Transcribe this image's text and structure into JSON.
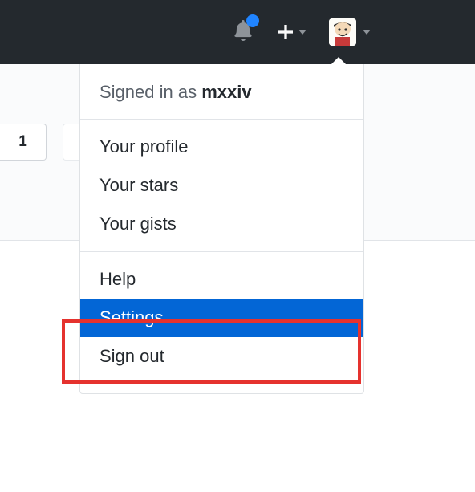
{
  "topbar": {
    "notification_dot": true
  },
  "page": {
    "button_number": "1"
  },
  "dropdown": {
    "signed_in_prefix": "Signed in as ",
    "username": "mxxiv",
    "items_a": [
      "Your profile",
      "Your stars",
      "Your gists"
    ],
    "items_b": [
      "Help",
      "Settings",
      "Sign out"
    ],
    "highlighted": "Settings"
  }
}
